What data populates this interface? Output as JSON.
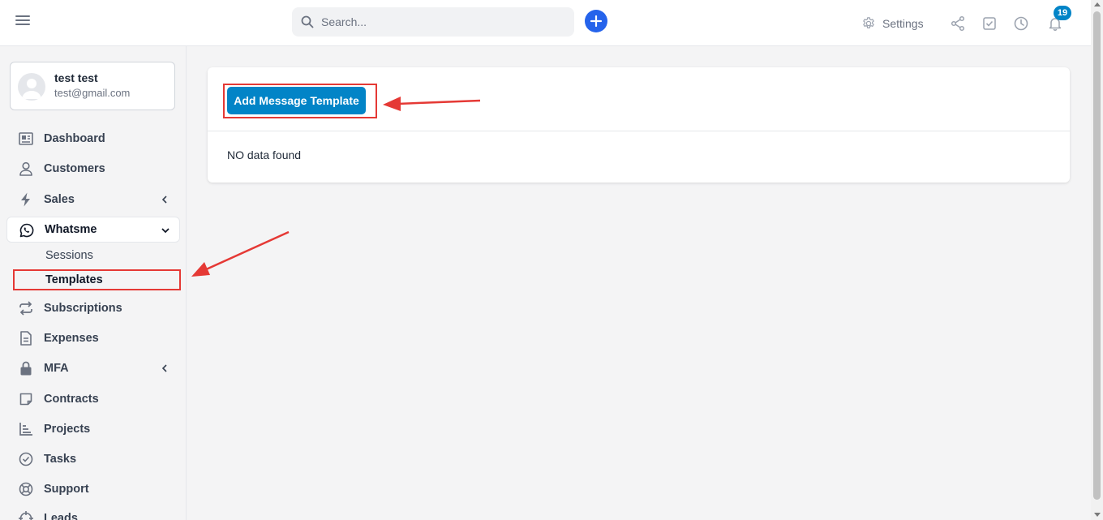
{
  "topbar": {
    "search_placeholder": "Search...",
    "settings_label": "Settings",
    "notification_count": "19"
  },
  "user": {
    "name": "test test",
    "email": "test@gmail.com"
  },
  "sidebar": {
    "items": [
      {
        "label": "Dashboard",
        "icon": "dashboard-icon"
      },
      {
        "label": "Customers",
        "icon": "user-icon"
      },
      {
        "label": "Sales",
        "icon": "bolt-icon"
      },
      {
        "label": "Whatsme",
        "icon": "whatsapp-icon"
      },
      {
        "label": "Subscriptions",
        "icon": "repeat-icon"
      },
      {
        "label": "Expenses",
        "icon": "document-icon"
      },
      {
        "label": "MFA",
        "icon": "lock-icon"
      },
      {
        "label": "Contracts",
        "icon": "contract-icon"
      },
      {
        "label": "Projects",
        "icon": "chart-icon"
      },
      {
        "label": "Tasks",
        "icon": "check-circle-icon"
      },
      {
        "label": "Support",
        "icon": "lifebuoy-icon"
      },
      {
        "label": "Leads",
        "icon": "crosshair-icon"
      }
    ],
    "whatsme_sub": [
      {
        "label": "Sessions"
      },
      {
        "label": "Templates"
      }
    ]
  },
  "main": {
    "add_button_label": "Add Message Template",
    "empty_message": "NO data found"
  },
  "colors": {
    "primary": "#0284c7",
    "plus_button": "#2563eb",
    "annotation_red": "#e53935"
  }
}
